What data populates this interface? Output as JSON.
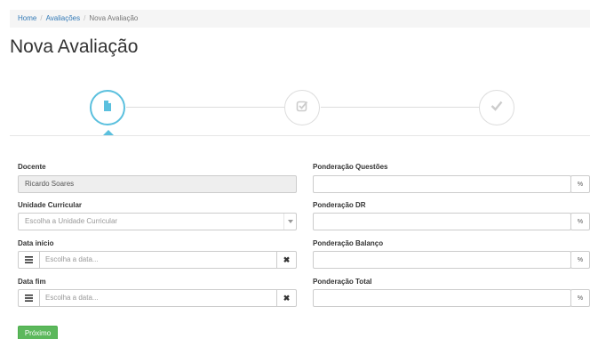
{
  "breadcrumb": {
    "items": [
      "Home",
      "Avaliações",
      "Nova Avaliação"
    ],
    "separator": "/"
  },
  "page_title": "Nova Avaliação",
  "wizard": {
    "steps": [
      {
        "icon": "file-icon",
        "state": "active"
      },
      {
        "icon": "check-square-icon",
        "state": "inactive"
      },
      {
        "icon": "check-icon",
        "state": "inactive"
      }
    ],
    "active_color": "#5bc0de"
  },
  "form": {
    "docente": {
      "label": "Docente",
      "value": "Ricardo Soares"
    },
    "unidade": {
      "label": "Unidade Curricular",
      "placeholder": "Escolha a Unidade Curricular"
    },
    "data_inicio": {
      "label": "Data início",
      "placeholder": "Escolha a data...",
      "clear": "✖"
    },
    "data_fim": {
      "label": "Data fim",
      "placeholder": "Escolha a data...",
      "clear": "✖"
    },
    "pond_questoes": {
      "label": "Ponderação Questões",
      "value": "",
      "unit": "%"
    },
    "pond_dr": {
      "label": "Ponderação DR",
      "value": "",
      "unit": "%"
    },
    "pond_balanco": {
      "label": "Ponderação Balanço",
      "value": "",
      "unit": "%"
    },
    "pond_total": {
      "label": "Ponderação Total",
      "value": "",
      "unit": "%"
    }
  },
  "next_button": {
    "label": "Próximo",
    "color": "#5cb85c"
  }
}
